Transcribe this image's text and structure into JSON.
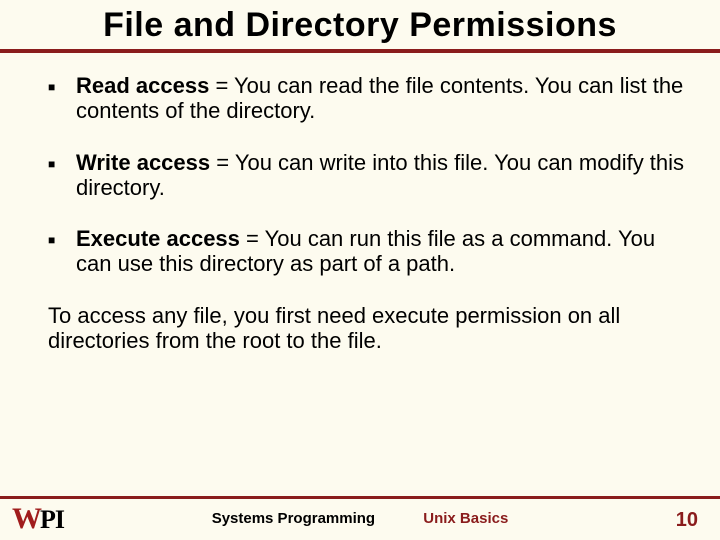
{
  "title": "File and Directory Permissions",
  "bullets": [
    {
      "term": "Read access",
      "rest": " = You can read the file contents. You can list the contents of the directory."
    },
    {
      "term": "Write access",
      "rest": " = You can write into this file. You can modify this directory."
    },
    {
      "term": "Execute access",
      "rest": " = You can run this file as a command. You can use this directory as part of a path."
    }
  ],
  "note": "To access any file, you first need execute permission on all directories from the root to the file.",
  "footer": {
    "course": "Systems Programming",
    "topic": "Unix Basics",
    "page": "10",
    "logo_w": "W",
    "logo_pi": "PI"
  }
}
